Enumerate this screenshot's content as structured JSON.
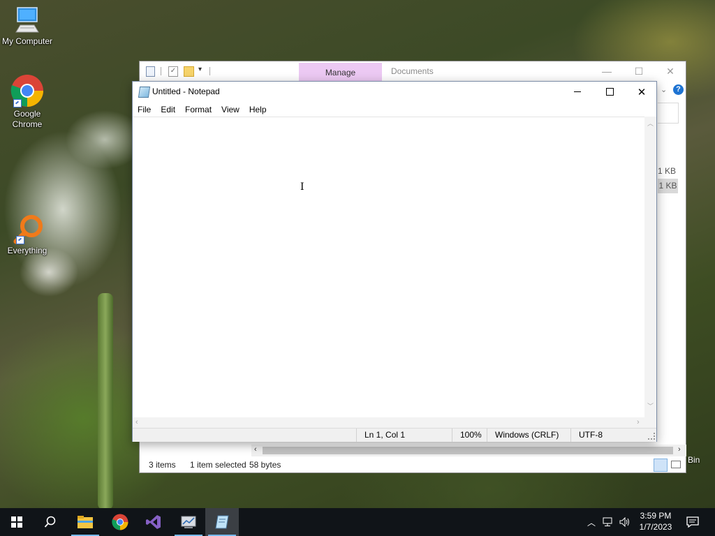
{
  "desktop": {
    "icons": [
      {
        "label": "My Computer",
        "icon": "computer-icon"
      },
      {
        "label": "Google Chrome",
        "line1": "Google",
        "line2": "Chrome",
        "icon": "chrome-icon"
      },
      {
        "label": "Everything",
        "icon": "everything-search-icon"
      }
    ],
    "partial_label_bin": "Bin"
  },
  "explorer": {
    "ribbon_tab_manage": "Manage",
    "title": "Documents",
    "sizes": [
      "1 KB",
      "1 KB"
    ],
    "status": {
      "items": "3 items",
      "selected": "1 item selected",
      "size": "58 bytes"
    },
    "help_glyph": "?"
  },
  "notepad": {
    "title": "Untitled - Notepad",
    "menu": [
      "File",
      "Edit",
      "Format",
      "View",
      "Help"
    ],
    "content": "",
    "status": {
      "position": "Ln 1, Col 1",
      "zoom": "100%",
      "line_ending": "Windows (CRLF)",
      "encoding": "UTF-8"
    }
  },
  "taskbar": {
    "apps": [
      "start-icon",
      "search-icon",
      "file-explorer-icon",
      "chrome-icon",
      "visual-studio-icon",
      "system-app-icon",
      "notepad-icon"
    ],
    "clock": {
      "time": "3:59 PM",
      "date": "1/7/2023"
    }
  },
  "colors": {
    "manage_tab": "#ecc9f3",
    "taskbar": "#101418",
    "accent": "#76b9ed"
  }
}
